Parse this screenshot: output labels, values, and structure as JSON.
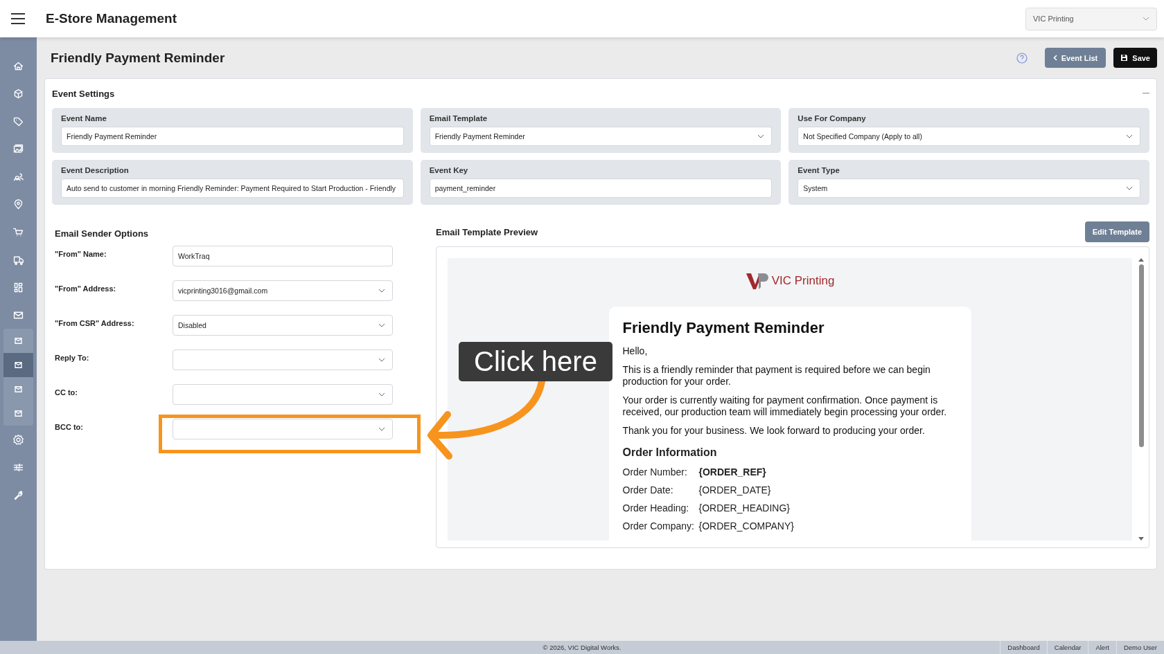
{
  "app": {
    "title": "E-Store Management",
    "company_select": {
      "value": "VIC Printing"
    }
  },
  "sidebar": {
    "items": [
      {
        "selected": false
      },
      {
        "selected": false
      },
      {
        "selected": false
      },
      {
        "selected": false
      },
      {
        "selected": false
      },
      {
        "selected": false
      },
      {
        "selected": false
      },
      {
        "selected": false
      },
      {
        "selected": false
      },
      {
        "selected": false,
        "expanded": true,
        "children": [
          {
            "selected": false
          },
          {
            "selected": true
          },
          {
            "selected": false
          },
          {
            "selected": false
          }
        ]
      },
      {
        "selected": false
      },
      {
        "selected": false
      },
      {
        "selected": false
      }
    ]
  },
  "page": {
    "title": "Friendly Payment Reminder",
    "buttons": [
      {
        "kind": "help"
      },
      {
        "kind": "back",
        "label": "Event List"
      },
      {
        "kind": "save",
        "label": "Save"
      }
    ]
  },
  "event_settings": {
    "title": "Event Settings",
    "fields": [
      {
        "label": "Event Name",
        "value": "Friendly Payment Reminder",
        "kind": "text"
      },
      {
        "label": "Email Template",
        "value": "Friendly Payment Reminder",
        "kind": "select"
      },
      {
        "label": "Use For Company",
        "value": "Not Specified Company (Apply to all)",
        "kind": "select"
      },
      {
        "label": "Event Description",
        "value": "Auto send to customer in morning Friendly Reminder: Payment Required to Start Production - Friendly",
        "kind": "text"
      },
      {
        "label": "Event Key",
        "value": "payment_reminder",
        "kind": "text"
      },
      {
        "label": "Event Type",
        "value": "System",
        "kind": "select"
      }
    ]
  },
  "sender_options": {
    "title": "Email Sender Options",
    "fields": [
      {
        "label": "\"From\" Name:",
        "value": "WorkTraq",
        "kind": "text"
      },
      {
        "label": "\"From\" Address:",
        "value": "vicprinting3016@gmail.com",
        "kind": "select"
      },
      {
        "label": "\"From CSR\" Address:",
        "value": "Disabled",
        "kind": "select"
      },
      {
        "label": "Reply To:",
        "kind": "select"
      },
      {
        "label": "CC to:",
        "kind": "select"
      },
      {
        "label": "BCC to:",
        "kind": "select"
      }
    ]
  },
  "preview": {
    "title": "Email Template Preview",
    "edit_button": "Edit Template",
    "logo_text": "VIC Printing",
    "email": {
      "heading": "Friendly Payment Reminder",
      "paragraphs": [
        "Hello,",
        "This is a friendly reminder that payment is required before we can begin production for your order.",
        "Your order is currently waiting for payment confirmation. Once payment is received, our production team will immediately begin processing your order.",
        "Thank you for your business. We look forward to producing your order."
      ],
      "section_title": "Order Information",
      "rows": [
        {
          "label": "Order Number:",
          "value": "{ORDER_REF}",
          "bold": true
        },
        {
          "label": "Order Date:",
          "value": "{ORDER_DATE}",
          "bold": false
        },
        {
          "label": "Order Heading:",
          "value": "{ORDER_HEADING}",
          "bold": false
        },
        {
          "label": "Order Company:",
          "value": "{ORDER_COMPANY}",
          "bold": false
        }
      ]
    }
  },
  "annotation": {
    "callout": "Click here"
  },
  "footer": {
    "copyright": "© 2026, VIC Digital Works.",
    "links": [
      "Dashboard",
      "Calendar",
      "Alert",
      "Demo User"
    ]
  }
}
